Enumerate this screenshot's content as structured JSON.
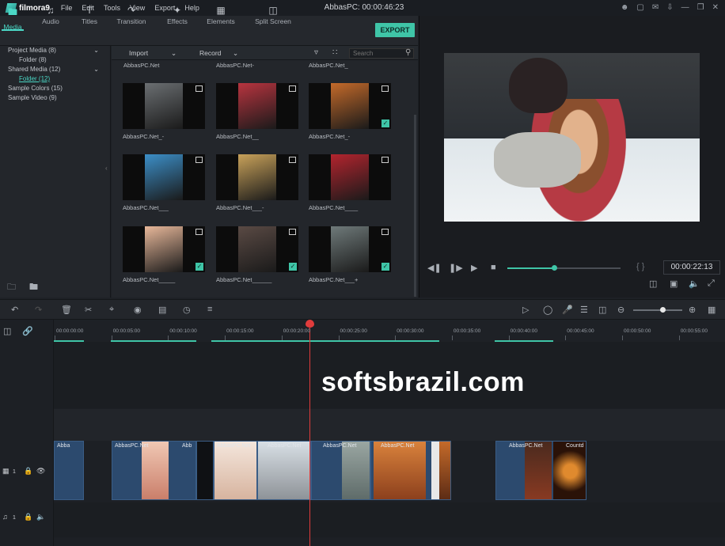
{
  "app": {
    "name": "filmora9",
    "window_title": "AbbasPC:  00:00:46:23"
  },
  "menu": [
    "File",
    "Edit",
    "Tools",
    "View",
    "Export",
    "Help"
  ],
  "tabs": [
    {
      "label": "Media",
      "icon": "folder-icon",
      "active": true
    },
    {
      "label": "Audio",
      "icon": "music-note-icon"
    },
    {
      "label": "Titles",
      "icon": "text-icon"
    },
    {
      "label": "Transition",
      "icon": "transition-icon"
    },
    {
      "label": "Effects",
      "icon": "effects-icon"
    },
    {
      "label": "Elements",
      "icon": "elements-icon"
    },
    {
      "label": "Split Screen",
      "icon": "split-screen-icon"
    }
  ],
  "export_label": "EXPORT",
  "tree": [
    {
      "label": "Project Media (8)"
    },
    {
      "label": "Folder (8)"
    },
    {
      "label": "Shared Media (12)"
    },
    {
      "label": "Folder (12)"
    },
    {
      "label": "Sample Colors (15)"
    },
    {
      "label": "Sample Video (9)"
    }
  ],
  "media_toolbar": {
    "import": "Import",
    "record": "Record",
    "search_placeholder": "Search"
  },
  "top_captions": [
    "AbbasPC.Net",
    "AbbasPC.Net-",
    "AbbasPC.Net_"
  ],
  "media": [
    {
      "caption": "AbbasPC.Net_-",
      "checked": false,
      "color": "#6b6f72"
    },
    {
      "caption": "AbbasPC.Net__",
      "checked": false,
      "color": "#b8343f"
    },
    {
      "caption": "AbbasPC.Net_-",
      "checked": true,
      "color": "#c46a2a"
    },
    {
      "caption": "AbbasPC.Net___",
      "checked": false,
      "color": "#3c8fc8"
    },
    {
      "caption": "AbbasPC.Net___-",
      "checked": false,
      "color": "#c9a25a"
    },
    {
      "caption": "AbbasPC.Net____",
      "checked": false,
      "color": "#b3242e"
    },
    {
      "caption": "AbbasPC.Net_____",
      "checked": true,
      "color": "#e8b89a"
    },
    {
      "caption": "AbbasPC.Net______",
      "checked": true,
      "color": "#5a4a44"
    },
    {
      "caption": "AbbasPC.Net___+",
      "checked": true,
      "color": "#6f7a7a"
    }
  ],
  "player": {
    "time": "00:00:22:13",
    "progress": 0.41
  },
  "ruler_ticks": [
    "00:00:00:00",
    "00:00:05:00",
    "00:00:10:00",
    "00:00:15:00",
    "00:00:20:00",
    "00:00:25:00",
    "00:00:30:00",
    "00:00:35:00",
    "00:00:40:00",
    "00:00:45:00",
    "00:00:50:00",
    "00:00:55:00"
  ],
  "tracks": {
    "video_label": "1",
    "audio_label": "1"
  },
  "clips": [
    {
      "label": "Abba"
    },
    {
      "label": "AbbasPC.Net"
    },
    {
      "label": "Abb"
    },
    {
      "label": "AbbasPC.Net"
    },
    {
      "label": "AbbasPC.Net"
    },
    {
      "label": "AbbasPC.Net"
    },
    {
      "label": "AbbasPC.Net"
    },
    {
      "label": "Countd"
    }
  ],
  "watermark": "softsbrazil.com"
}
